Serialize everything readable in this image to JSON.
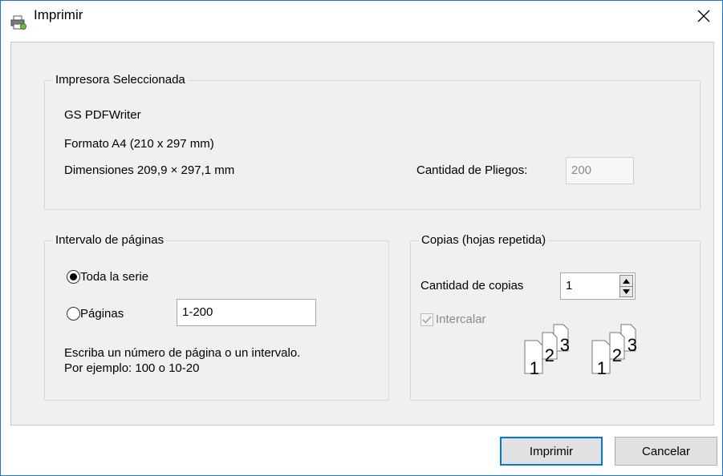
{
  "window": {
    "title": "Imprimir"
  },
  "printer_group": {
    "legend": "Impresora Seleccionada",
    "name": "GS PDFWriter",
    "format": "Formato A4 (210 x 297 mm)",
    "dimensions": "Dimensiones 209,9 × 297,1  mm",
    "sheets_label": "Cantidad de Pliegos:",
    "sheets_value": "200"
  },
  "range_group": {
    "legend": "Intervalo de páginas",
    "option_all": "Toda la serie",
    "option_pages": "Páginas",
    "pages_value": "1-200",
    "help_line1": "Escriba un número de página o un intervalo.",
    "help_line2": "Por ejemplo: 100 o 10-20"
  },
  "copies_group": {
    "legend": "Copias (hojas repetida)",
    "count_label": "Cantidad de copias",
    "count_value": "1",
    "collate_label": "Intercalar",
    "collate_checked": true,
    "page_numbers": [
      "1",
      "2",
      "3"
    ]
  },
  "buttons": {
    "print": "Imprimir",
    "cancel": "Cancelar"
  },
  "colors": {
    "accent": "#0078d7",
    "panel_bg": "#f0f0f0"
  }
}
